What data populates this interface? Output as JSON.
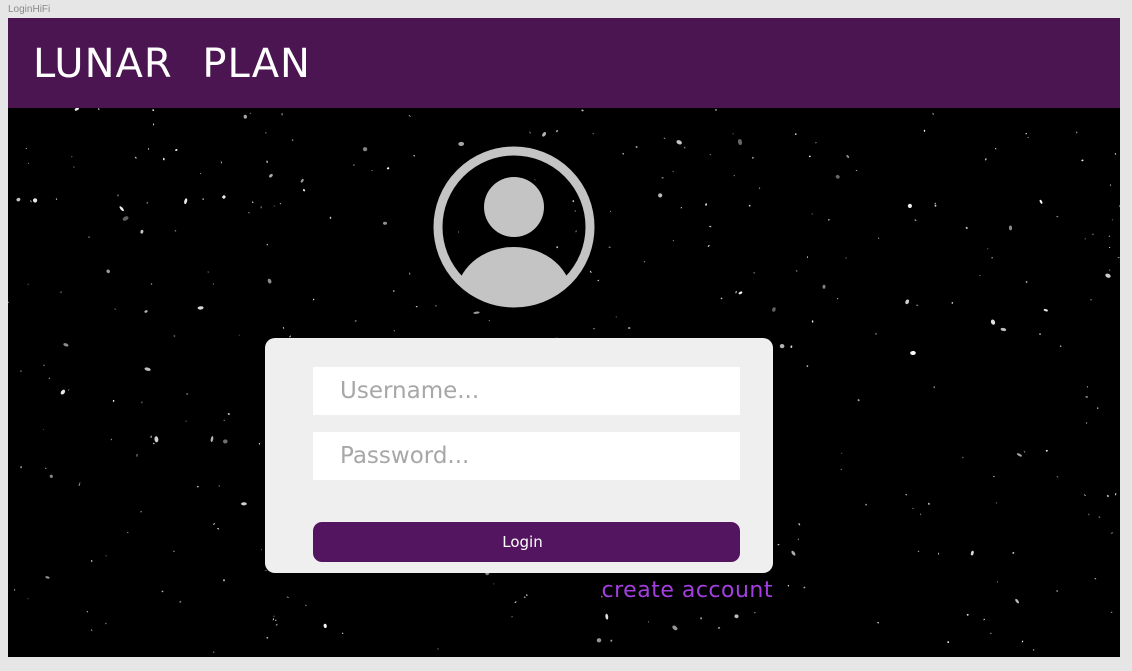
{
  "frame": {
    "label": "LoginHiFi"
  },
  "header": {
    "title": "LUNAR PLAN",
    "background_color": "#4a1550"
  },
  "avatar": {
    "icon": "user-avatar-icon",
    "color": "#c4c4c4"
  },
  "login_form": {
    "username": {
      "value": "",
      "placeholder": "Username..."
    },
    "password": {
      "value": "",
      "placeholder": "Password..."
    },
    "submit_label": "Login",
    "button_color": "#53155f"
  },
  "links": {
    "create_account": "create account",
    "link_color": "#a33fe0"
  }
}
